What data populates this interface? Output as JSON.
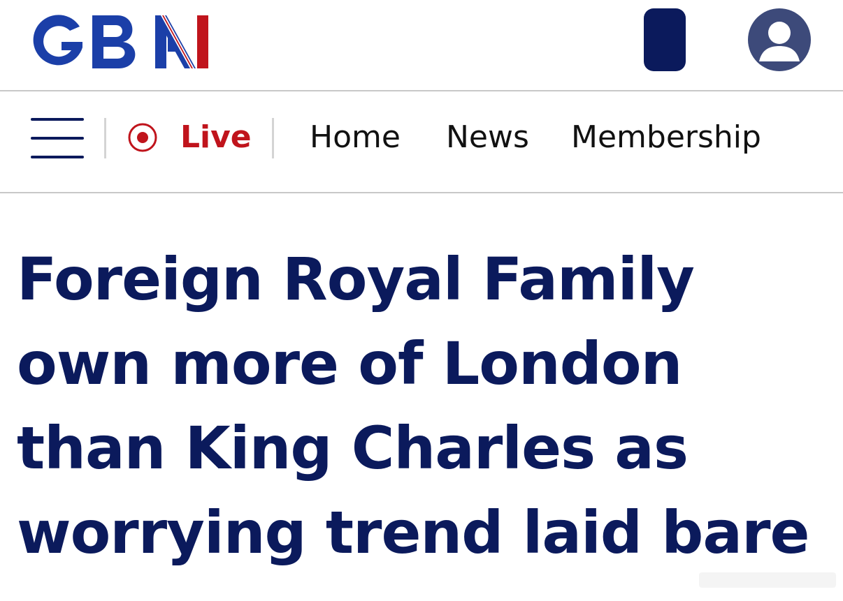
{
  "brand": {
    "logo_text": "GBN",
    "colors": {
      "primary_navy": "#0b1a5c",
      "logo_blue": "#1b3fa8",
      "live_red": "#c0141c",
      "divider_grey": "#c8c8c8"
    }
  },
  "header": {
    "device_icon": "phone-icon",
    "account_icon": "user-icon"
  },
  "nav": {
    "menu_icon": "hamburger-menu-icon",
    "live": {
      "icon": "live-record-icon",
      "label": "Live"
    },
    "links": [
      {
        "label": "Home"
      },
      {
        "label": "News"
      },
      {
        "label": "Membership"
      }
    ]
  },
  "article": {
    "headline_lines": [
      "Foreign Royal Family",
      "own more of London",
      "than King Charles as",
      "worrying trend laid bare"
    ]
  }
}
